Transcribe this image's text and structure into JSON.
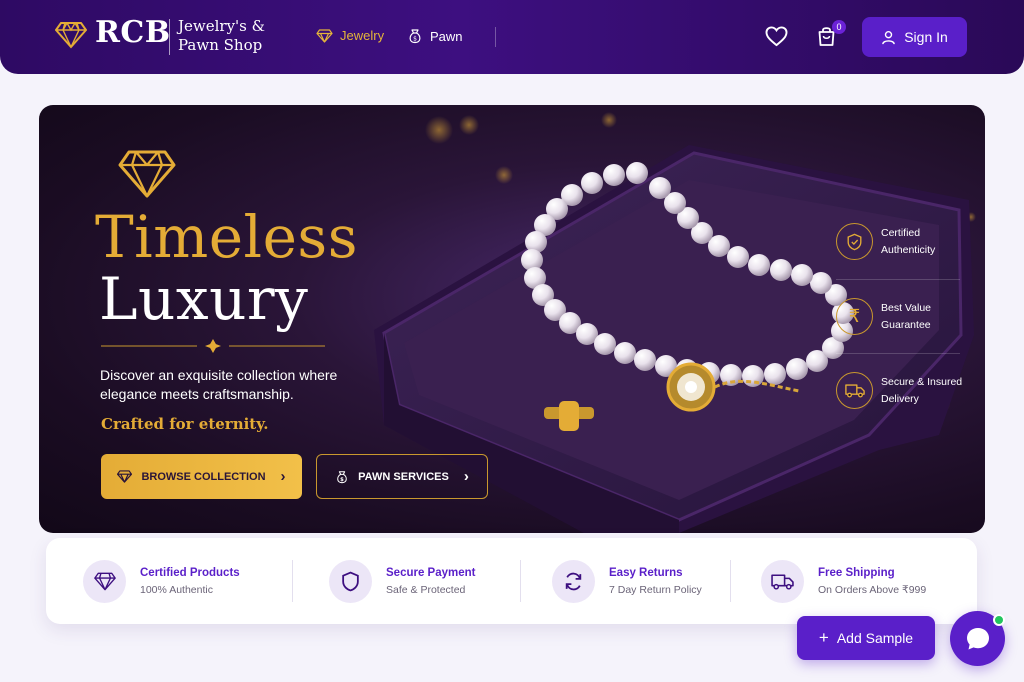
{
  "header": {
    "brand": "RCB",
    "brand_sub": "Jewelry's & Pawn Shop",
    "nav": [
      {
        "label": "Jewelry",
        "icon": "diamond-icon",
        "active": true
      },
      {
        "label": "Pawn",
        "icon": "money-bag-icon",
        "active": false
      }
    ],
    "cart_count": "0",
    "signin_label": "Sign In"
  },
  "hero": {
    "title_line1": "Timeless",
    "title_line2": "Luxury",
    "description": "Discover an exquisite collection where elegance meets craftsmanship.",
    "tagline": "Crafted for eternity.",
    "browse_label": "BROWSE COLLECTION",
    "pawn_label": "PAWN SERVICES",
    "features": [
      {
        "line1": "Certified",
        "line2": "Authenticity",
        "icon": "shield-check-icon"
      },
      {
        "line1": "Best Value",
        "line2": "Guarantee",
        "icon": "rupee-icon"
      },
      {
        "line1": "Secure & Insured",
        "line2": "Delivery",
        "icon": "truck-icon"
      }
    ]
  },
  "info_strip": [
    {
      "title": "Certified Products",
      "subtitle": "100% Authentic",
      "icon": "diamond-icon"
    },
    {
      "title": "Secure Payment",
      "subtitle": "Safe & Protected",
      "icon": "shield-icon"
    },
    {
      "title": "Easy Returns",
      "subtitle": "7 Day Return Policy",
      "icon": "refresh-icon"
    },
    {
      "title": "Free Shipping",
      "subtitle": "On Orders Above ₹999",
      "icon": "truck-icon"
    }
  ],
  "add_sample_label": "Add Sample",
  "colors": {
    "primary": "#5a1fc9",
    "gold": "#e4ac36",
    "header": "#3d0f80"
  }
}
